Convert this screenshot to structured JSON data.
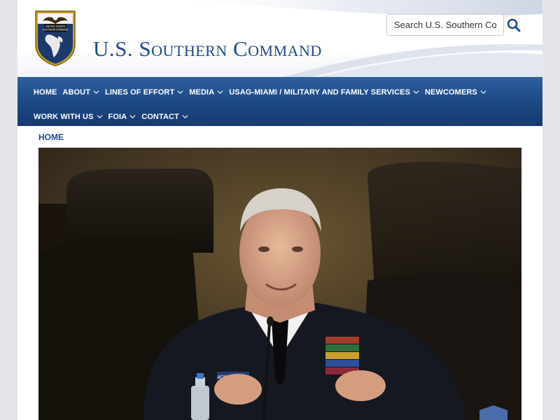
{
  "header": {
    "site_title": "U.S. Southern Command",
    "seal_label_line1": "UNITED STATES",
    "seal_label_line2": "SOUTHERN COMMAND",
    "search_placeholder": "Search U.S. Southern Command",
    "search_icon": "search-icon",
    "brand_color": "#1f4b8e"
  },
  "nav": {
    "items_row1": [
      {
        "label": "HOME",
        "has_dropdown": false
      },
      {
        "label": "ABOUT",
        "has_dropdown": true
      },
      {
        "label": "LINES OF EFFORT",
        "has_dropdown": true
      },
      {
        "label": "MEDIA",
        "has_dropdown": true
      },
      {
        "label": "USAG-MIAMI / MILITARY AND FAMILY SERVICES",
        "has_dropdown": true
      },
      {
        "label": "NEWCOMERS",
        "has_dropdown": true
      }
    ],
    "items_row2": [
      {
        "label": "WORK WITH US",
        "has_dropdown": true
      },
      {
        "label": "FOIA",
        "has_dropdown": true
      },
      {
        "label": "CONTACT",
        "has_dropdown": true
      }
    ]
  },
  "breadcrumb": {
    "home_label": "HOME"
  },
  "hero": {
    "name_plate": "ADM. FALLER"
  }
}
